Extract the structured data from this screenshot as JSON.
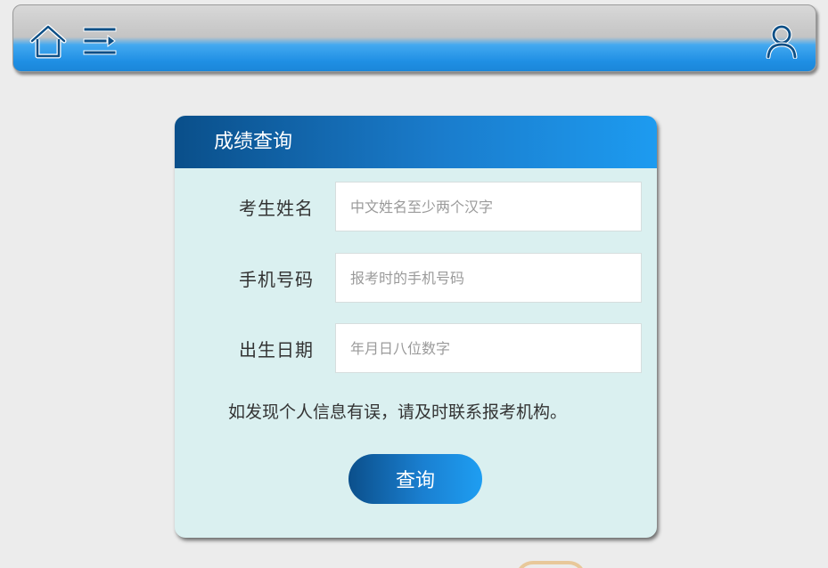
{
  "topbar": {
    "icons": {
      "home": "home-icon",
      "menu": "menu-icon",
      "user": "user-icon"
    }
  },
  "card": {
    "title": "成绩查询",
    "fields": {
      "name": {
        "label": "考生姓名",
        "placeholder": "中文姓名至少两个汉字",
        "value": ""
      },
      "phone": {
        "label": "手机号码",
        "placeholder": "报考时的手机号码",
        "value": ""
      },
      "birth": {
        "label": "出生日期",
        "placeholder": "年月日八位数字",
        "value": ""
      }
    },
    "notice": "如发现个人信息有误，请及时联系报考机构。",
    "submit_label": "查询"
  },
  "colors": {
    "accent": "#1d8fe4",
    "header_dark": "#0a4f8a",
    "card_bg": "#daf0f0",
    "page_bg": "#ececec"
  }
}
